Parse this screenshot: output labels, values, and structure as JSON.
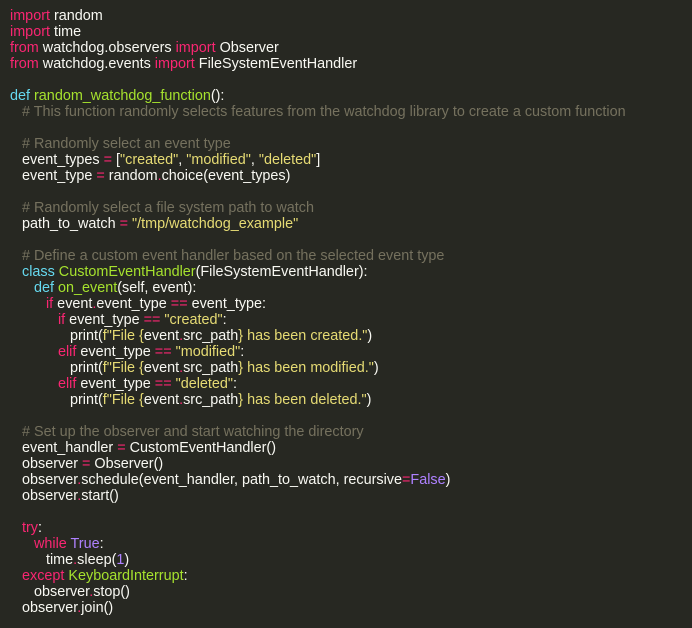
{
  "colors": {
    "background": "#272822",
    "default": "#f8f8f2",
    "keyword": "#f92672",
    "function": "#a6e22e",
    "string": "#e6db74",
    "comment": "#75715e",
    "constant": "#ae81ff",
    "builtin": "#66d9ef"
  },
  "code": {
    "lines": [
      [
        [
          "kw",
          "import"
        ],
        [
          "df",
          " random"
        ]
      ],
      [
        [
          "kw",
          "import"
        ],
        [
          "df",
          " time"
        ]
      ],
      [
        [
          "kw",
          "from"
        ],
        [
          "df",
          " watchdog.observers "
        ],
        [
          "kw",
          "import"
        ],
        [
          "df",
          " Observer"
        ]
      ],
      [
        [
          "kw",
          "from"
        ],
        [
          "df",
          " watchdog.events "
        ],
        [
          "kw",
          "import"
        ],
        [
          "df",
          " FileSystemEventHandler"
        ]
      ],
      [],
      [
        [
          "bi",
          "def"
        ],
        [
          "df",
          " "
        ],
        [
          "fn",
          "random_watchdog_function"
        ],
        [
          "df",
          "():"
        ]
      ],
      [
        [
          "df",
          "   "
        ],
        [
          "cm",
          "# This function randomly selects features from the watchdog library to create a custom function"
        ]
      ],
      [],
      [
        [
          "df",
          "   "
        ],
        [
          "cm",
          "# Randomly select an event type"
        ]
      ],
      [
        [
          "df",
          "   event_types "
        ],
        [
          "kw",
          "="
        ],
        [
          "df",
          " ["
        ],
        [
          "st",
          "\"created\""
        ],
        [
          "df",
          ", "
        ],
        [
          "st",
          "\"modified\""
        ],
        [
          "df",
          ", "
        ],
        [
          "st",
          "\"deleted\""
        ],
        [
          "df",
          "]"
        ]
      ],
      [
        [
          "df",
          "   event_type "
        ],
        [
          "kw",
          "="
        ],
        [
          "df",
          " random"
        ],
        [
          "kw",
          "."
        ],
        [
          "df",
          "choice(event_types)"
        ]
      ],
      [],
      [
        [
          "df",
          "   "
        ],
        [
          "cm",
          "# Randomly select a file system path to watch"
        ]
      ],
      [
        [
          "df",
          "   path_to_watch "
        ],
        [
          "kw",
          "="
        ],
        [
          "df",
          " "
        ],
        [
          "st",
          "\"/tmp/watchdog_example\""
        ]
      ],
      [],
      [
        [
          "df",
          "   "
        ],
        [
          "cm",
          "# Define a custom event handler based on the selected event type"
        ]
      ],
      [
        [
          "df",
          "   "
        ],
        [
          "bi",
          "class"
        ],
        [
          "df",
          " "
        ],
        [
          "fn",
          "CustomEventHandler"
        ],
        [
          "df",
          "(FileSystemEventHandler):"
        ]
      ],
      [
        [
          "df",
          "      "
        ],
        [
          "bi",
          "def"
        ],
        [
          "df",
          " "
        ],
        [
          "fn",
          "on_event"
        ],
        [
          "df",
          "(self, event):"
        ]
      ],
      [
        [
          "df",
          "         "
        ],
        [
          "kw",
          "if"
        ],
        [
          "df",
          " event"
        ],
        [
          "kw",
          "."
        ],
        [
          "df",
          "event_type "
        ],
        [
          "kw",
          "=="
        ],
        [
          "df",
          " event_type:"
        ]
      ],
      [
        [
          "df",
          "            "
        ],
        [
          "kw",
          "if"
        ],
        [
          "df",
          " event_type "
        ],
        [
          "kw",
          "=="
        ],
        [
          "df",
          " "
        ],
        [
          "st",
          "\"created\""
        ],
        [
          "df",
          ":"
        ]
      ],
      [
        [
          "df",
          "               print("
        ],
        [
          "st",
          "f\"File {"
        ],
        [
          "df",
          "event"
        ],
        [
          "kw",
          "."
        ],
        [
          "df",
          "src_path"
        ],
        [
          "st",
          "} has been created.\""
        ],
        [
          "df",
          ")"
        ]
      ],
      [
        [
          "df",
          "            "
        ],
        [
          "kw",
          "elif"
        ],
        [
          "df",
          " event_type "
        ],
        [
          "kw",
          "=="
        ],
        [
          "df",
          " "
        ],
        [
          "st",
          "\"modified\""
        ],
        [
          "df",
          ":"
        ]
      ],
      [
        [
          "df",
          "               print("
        ],
        [
          "st",
          "f\"File {"
        ],
        [
          "df",
          "event"
        ],
        [
          "kw",
          "."
        ],
        [
          "df",
          "src_path"
        ],
        [
          "st",
          "} has been modified.\""
        ],
        [
          "df",
          ")"
        ]
      ],
      [
        [
          "df",
          "            "
        ],
        [
          "kw",
          "elif"
        ],
        [
          "df",
          " event_type "
        ],
        [
          "kw",
          "=="
        ],
        [
          "df",
          " "
        ],
        [
          "st",
          "\"deleted\""
        ],
        [
          "df",
          ":"
        ]
      ],
      [
        [
          "df",
          "               print("
        ],
        [
          "st",
          "f\"File {"
        ],
        [
          "df",
          "event"
        ],
        [
          "kw",
          "."
        ],
        [
          "df",
          "src_path"
        ],
        [
          "st",
          "} has been deleted.\""
        ],
        [
          "df",
          ")"
        ]
      ],
      [],
      [
        [
          "df",
          "   "
        ],
        [
          "cm",
          "# Set up the observer and start watching the directory"
        ]
      ],
      [
        [
          "df",
          "   event_handler "
        ],
        [
          "kw",
          "="
        ],
        [
          "df",
          " CustomEventHandler()"
        ]
      ],
      [
        [
          "df",
          "   observer "
        ],
        [
          "kw",
          "="
        ],
        [
          "df",
          " Observer()"
        ]
      ],
      [
        [
          "df",
          "   observer"
        ],
        [
          "kw",
          "."
        ],
        [
          "df",
          "schedule(event_handler, path_to_watch, recursive"
        ],
        [
          "kw",
          "="
        ],
        [
          "co",
          "False"
        ],
        [
          "df",
          ")"
        ]
      ],
      [
        [
          "df",
          "   observer"
        ],
        [
          "kw",
          "."
        ],
        [
          "df",
          "start()"
        ]
      ],
      [],
      [
        [
          "df",
          "   "
        ],
        [
          "kw",
          "try"
        ],
        [
          "df",
          ":"
        ]
      ],
      [
        [
          "df",
          "      "
        ],
        [
          "kw",
          "while"
        ],
        [
          "df",
          " "
        ],
        [
          "co",
          "True"
        ],
        [
          "df",
          ":"
        ]
      ],
      [
        [
          "df",
          "         time"
        ],
        [
          "kw",
          "."
        ],
        [
          "df",
          "sleep("
        ],
        [
          "co",
          "1"
        ],
        [
          "df",
          ")"
        ]
      ],
      [
        [
          "df",
          "   "
        ],
        [
          "kw",
          "except"
        ],
        [
          "df",
          " "
        ],
        [
          "fn",
          "KeyboardInterrupt"
        ],
        [
          "df",
          ":"
        ]
      ],
      [
        [
          "df",
          "      observer"
        ],
        [
          "kw",
          "."
        ],
        [
          "df",
          "stop()"
        ]
      ],
      [
        [
          "df",
          "   observer"
        ],
        [
          "kw",
          "."
        ],
        [
          "df",
          "join()"
        ]
      ]
    ]
  }
}
